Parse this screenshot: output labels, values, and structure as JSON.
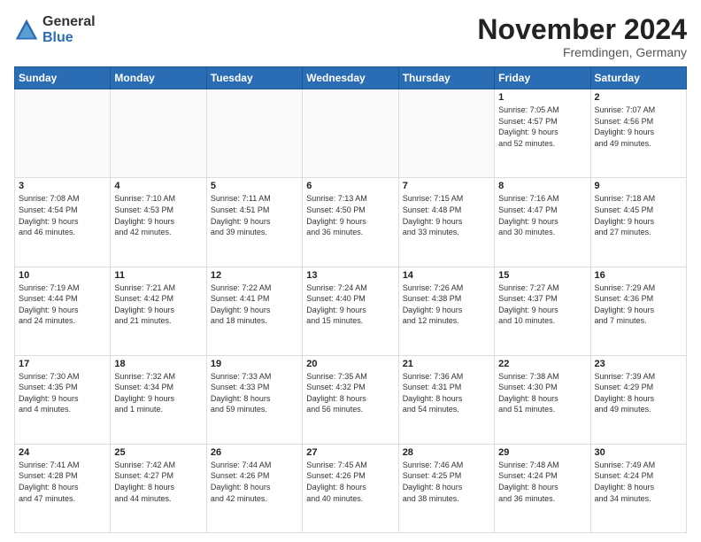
{
  "logo": {
    "general": "General",
    "blue": "Blue"
  },
  "header": {
    "month": "November 2024",
    "location": "Fremdingen, Germany"
  },
  "days_of_week": [
    "Sunday",
    "Monday",
    "Tuesday",
    "Wednesday",
    "Thursday",
    "Friday",
    "Saturday"
  ],
  "weeks": [
    [
      {
        "day": "",
        "info": ""
      },
      {
        "day": "",
        "info": ""
      },
      {
        "day": "",
        "info": ""
      },
      {
        "day": "",
        "info": ""
      },
      {
        "day": "",
        "info": ""
      },
      {
        "day": "1",
        "info": "Sunrise: 7:05 AM\nSunset: 4:57 PM\nDaylight: 9 hours\nand 52 minutes."
      },
      {
        "day": "2",
        "info": "Sunrise: 7:07 AM\nSunset: 4:56 PM\nDaylight: 9 hours\nand 49 minutes."
      }
    ],
    [
      {
        "day": "3",
        "info": "Sunrise: 7:08 AM\nSunset: 4:54 PM\nDaylight: 9 hours\nand 46 minutes."
      },
      {
        "day": "4",
        "info": "Sunrise: 7:10 AM\nSunset: 4:53 PM\nDaylight: 9 hours\nand 42 minutes."
      },
      {
        "day": "5",
        "info": "Sunrise: 7:11 AM\nSunset: 4:51 PM\nDaylight: 9 hours\nand 39 minutes."
      },
      {
        "day": "6",
        "info": "Sunrise: 7:13 AM\nSunset: 4:50 PM\nDaylight: 9 hours\nand 36 minutes."
      },
      {
        "day": "7",
        "info": "Sunrise: 7:15 AM\nSunset: 4:48 PM\nDaylight: 9 hours\nand 33 minutes."
      },
      {
        "day": "8",
        "info": "Sunrise: 7:16 AM\nSunset: 4:47 PM\nDaylight: 9 hours\nand 30 minutes."
      },
      {
        "day": "9",
        "info": "Sunrise: 7:18 AM\nSunset: 4:45 PM\nDaylight: 9 hours\nand 27 minutes."
      }
    ],
    [
      {
        "day": "10",
        "info": "Sunrise: 7:19 AM\nSunset: 4:44 PM\nDaylight: 9 hours\nand 24 minutes."
      },
      {
        "day": "11",
        "info": "Sunrise: 7:21 AM\nSunset: 4:42 PM\nDaylight: 9 hours\nand 21 minutes."
      },
      {
        "day": "12",
        "info": "Sunrise: 7:22 AM\nSunset: 4:41 PM\nDaylight: 9 hours\nand 18 minutes."
      },
      {
        "day": "13",
        "info": "Sunrise: 7:24 AM\nSunset: 4:40 PM\nDaylight: 9 hours\nand 15 minutes."
      },
      {
        "day": "14",
        "info": "Sunrise: 7:26 AM\nSunset: 4:38 PM\nDaylight: 9 hours\nand 12 minutes."
      },
      {
        "day": "15",
        "info": "Sunrise: 7:27 AM\nSunset: 4:37 PM\nDaylight: 9 hours\nand 10 minutes."
      },
      {
        "day": "16",
        "info": "Sunrise: 7:29 AM\nSunset: 4:36 PM\nDaylight: 9 hours\nand 7 minutes."
      }
    ],
    [
      {
        "day": "17",
        "info": "Sunrise: 7:30 AM\nSunset: 4:35 PM\nDaylight: 9 hours\nand 4 minutes."
      },
      {
        "day": "18",
        "info": "Sunrise: 7:32 AM\nSunset: 4:34 PM\nDaylight: 9 hours\nand 1 minute."
      },
      {
        "day": "19",
        "info": "Sunrise: 7:33 AM\nSunset: 4:33 PM\nDaylight: 8 hours\nand 59 minutes."
      },
      {
        "day": "20",
        "info": "Sunrise: 7:35 AM\nSunset: 4:32 PM\nDaylight: 8 hours\nand 56 minutes."
      },
      {
        "day": "21",
        "info": "Sunrise: 7:36 AM\nSunset: 4:31 PM\nDaylight: 8 hours\nand 54 minutes."
      },
      {
        "day": "22",
        "info": "Sunrise: 7:38 AM\nSunset: 4:30 PM\nDaylight: 8 hours\nand 51 minutes."
      },
      {
        "day": "23",
        "info": "Sunrise: 7:39 AM\nSunset: 4:29 PM\nDaylight: 8 hours\nand 49 minutes."
      }
    ],
    [
      {
        "day": "24",
        "info": "Sunrise: 7:41 AM\nSunset: 4:28 PM\nDaylight: 8 hours\nand 47 minutes."
      },
      {
        "day": "25",
        "info": "Sunrise: 7:42 AM\nSunset: 4:27 PM\nDaylight: 8 hours\nand 44 minutes."
      },
      {
        "day": "26",
        "info": "Sunrise: 7:44 AM\nSunset: 4:26 PM\nDaylight: 8 hours\nand 42 minutes."
      },
      {
        "day": "27",
        "info": "Sunrise: 7:45 AM\nSunset: 4:26 PM\nDaylight: 8 hours\nand 40 minutes."
      },
      {
        "day": "28",
        "info": "Sunrise: 7:46 AM\nSunset: 4:25 PM\nDaylight: 8 hours\nand 38 minutes."
      },
      {
        "day": "29",
        "info": "Sunrise: 7:48 AM\nSunset: 4:24 PM\nDaylight: 8 hours\nand 36 minutes."
      },
      {
        "day": "30",
        "info": "Sunrise: 7:49 AM\nSunset: 4:24 PM\nDaylight: 8 hours\nand 34 minutes."
      }
    ]
  ]
}
